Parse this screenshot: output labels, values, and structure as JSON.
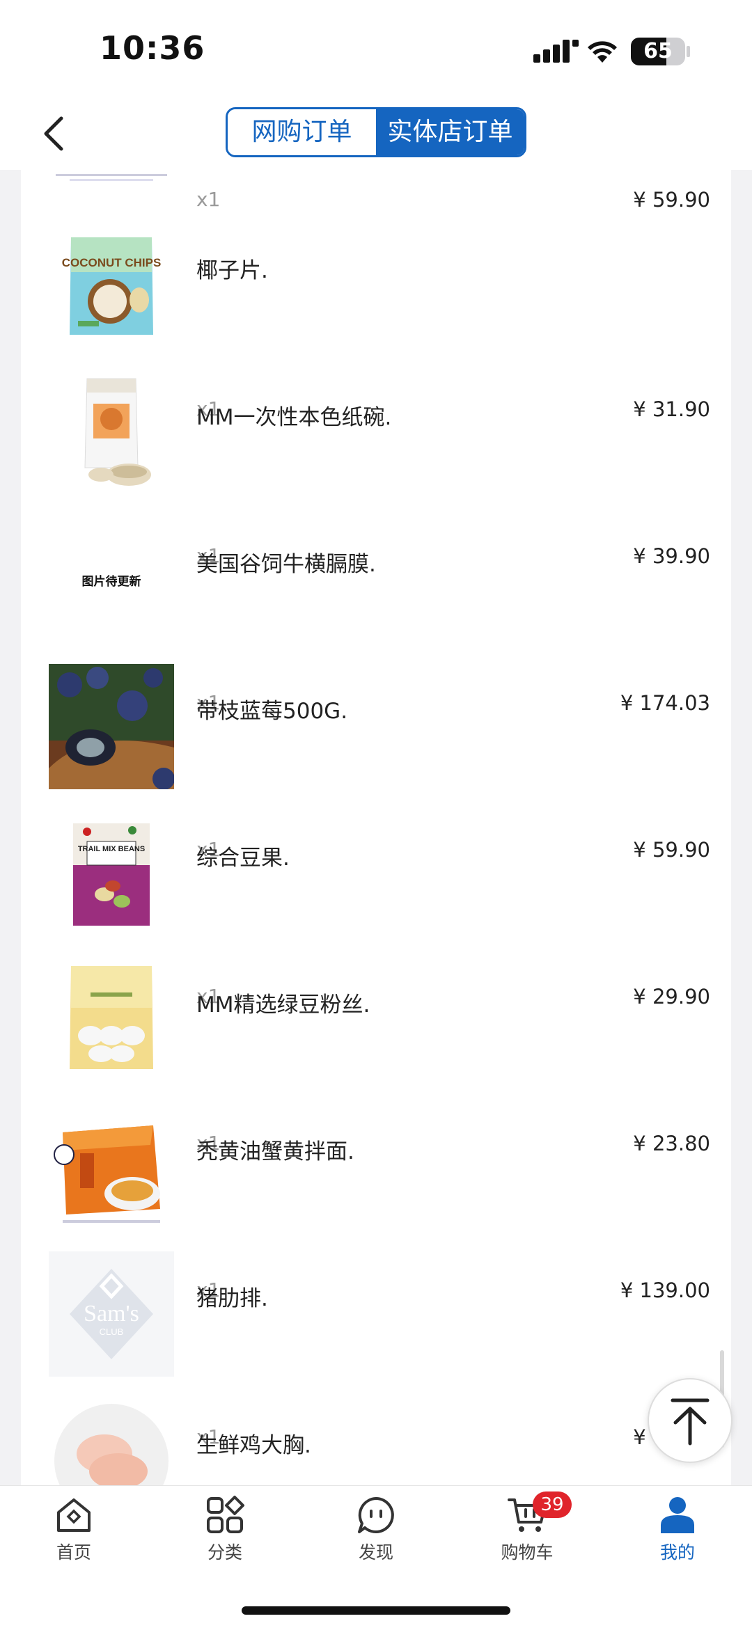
{
  "status": {
    "time": "10:36",
    "battery": "65",
    "battery_level": 0.65
  },
  "header": {
    "tabs": [
      {
        "label": "网购订单",
        "active": false
      },
      {
        "label": "实体店订单",
        "active": true
      }
    ]
  },
  "items": [
    {
      "name": "",
      "qty": "x1",
      "price": "¥ 59.90",
      "image": "spice-pack"
    },
    {
      "name": "椰子片.",
      "qty": "x1",
      "price": "¥ 31.90",
      "image": "coconut-chips"
    },
    {
      "name": "MM一次性本色纸碗.",
      "qty": "x1",
      "price": "¥ 39.90",
      "image": "paper-bowls"
    },
    {
      "name": "美国谷饲牛横膈膜.",
      "qty": "x1",
      "price": "¥ 174.03",
      "image": "placeholder",
      "placeholder_text": "图片待更新"
    },
    {
      "name": "带枝蓝莓500G.",
      "qty": "x1",
      "price": "¥ 59.90",
      "image": "blueberries"
    },
    {
      "name": "综合豆果.",
      "qty": "x1",
      "price": "¥ 29.90",
      "image": "trail-mix"
    },
    {
      "name": "MM精选绿豆粉丝.",
      "qty": "x1",
      "price": "¥ 23.80",
      "image": "vermicelli"
    },
    {
      "name": "秃黄油蟹黄拌面.",
      "qty": "x1",
      "price": "¥ 139.00",
      "image": "crab-noodles"
    },
    {
      "name": "猪肋排.",
      "qty": "x1",
      "price": "¥ 85.80",
      "image": "sams-logo"
    },
    {
      "name": "生鲜鸡大胸.",
      "qty": "",
      "price": "",
      "image": "chicken-breast"
    }
  ],
  "images": {
    "coconut_chips_text": "COCONUT CHIPS",
    "trail_mix_text": "TRAIL MIX BEANS",
    "sams_logo_text": "Sam's",
    "sams_logo_sub": "CLUB"
  },
  "tabbar": [
    {
      "label": "首页",
      "icon": "home-icon",
      "active": false
    },
    {
      "label": "分类",
      "icon": "category-icon",
      "active": false
    },
    {
      "label": "发现",
      "icon": "discover-icon",
      "active": false
    },
    {
      "label": "购物车",
      "icon": "cart-icon",
      "active": false,
      "badge": "39"
    },
    {
      "label": "我的",
      "icon": "profile-icon",
      "active": true
    }
  ],
  "colors": {
    "brand_blue": "#1565c0",
    "badge_red": "#e0242b"
  }
}
